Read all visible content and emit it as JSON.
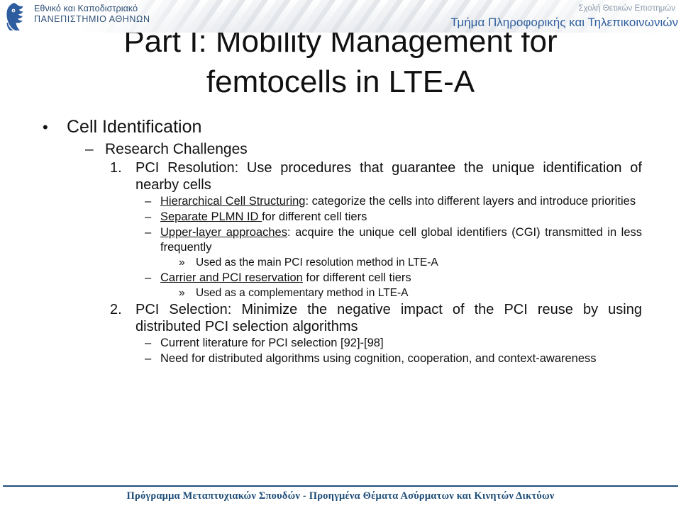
{
  "header": {
    "university_line1": "Εθνικό και Καποδιστριακό",
    "university_line2": "ΠΑΝΕΠΙΣΤΗΜΙΟ ΑΘΗΝΩΝ",
    "school": "Σχολή Θετικών Επιστημών",
    "department": "Τμήμα Πληροφορικής και Τηλεπικοινωνιών",
    "logo_alt": "university-owl-logo"
  },
  "title": {
    "line1": "Part I: Mobility Management for",
    "line2": "femtocells in LTE-A"
  },
  "content": {
    "topic": "Cell Identification",
    "topic_bullet": "•",
    "subtopic": "Research Challenges",
    "subtopic_dash": "–",
    "items": [
      {
        "number": "1.",
        "heading_bold": "PCI Resolution:",
        "heading_rest": " Use procedures that guarantee the unique identification of nearby cells",
        "subitems": [
          {
            "dash": "–",
            "underlined": "Hierarchical Cell Structuring",
            "rest": ": categorize the cells into different layers and introduce priorities",
            "subsubitems": []
          },
          {
            "dash": "–",
            "underlined": "Separate PLMN ID ",
            "rest": "for different cell tiers",
            "subsubitems": []
          },
          {
            "dash": "–",
            "underlined": "Upper-layer approaches",
            "rest": ": acquire the unique cell global identifiers (CGI) transmitted in less frequently",
            "subsubitems": [
              {
                "guillemet": "»",
                "text": "Used as the main PCI resolution method in LTE-A"
              }
            ]
          },
          {
            "dash": "–",
            "underlined": "Carrier and PCI reservation",
            "rest": " for different cell tiers",
            "subsubitems": [
              {
                "guillemet": "»",
                "text": "Used as a complementary method in LTE-A"
              }
            ]
          }
        ]
      },
      {
        "number": "2.",
        "heading_bold": "PCI Selection:",
        "heading_rest": " Minimize the negative impact of the PCI reuse by using distributed PCI selection algorithms",
        "subitems": [
          {
            "dash": "–",
            "underlined": "",
            "rest": "Current literature for PCI selection [92]-[98]",
            "subsubitems": []
          },
          {
            "dash": "–",
            "underlined": "",
            "rest": "Need for distributed algorithms using cognition, cooperation, and context-awareness",
            "subsubitems": []
          }
        ]
      }
    ]
  },
  "footer": {
    "text": "Πρόγραμμα Μεταπτυχιακών Σπουδών - Προηγμένα Θέματα Ασύρματων και Κινητών Δικτύων",
    "accent_color": "#1f4e79"
  }
}
